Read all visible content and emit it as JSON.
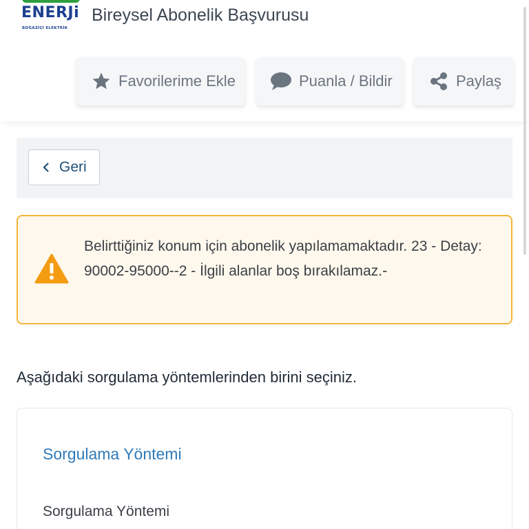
{
  "header": {
    "logo": {
      "word": "ENERJi",
      "sub": "BOĞAZİÇİ ELEKTRİK"
    },
    "title": "Bireysel Abonelik Başvurusu",
    "actions": {
      "favorite": "Favorilerime Ekle",
      "rate": "Puanla / Bildir",
      "share": "Paylaş"
    }
  },
  "back": {
    "label": "Geri"
  },
  "alert": {
    "message": "Belirttiğiniz konum için abonelik yapılamamaktadır. 23 - Detay: 90002-95000--2 - İlgili alanlar boş bırakılamaz.-"
  },
  "instruction": "Aşağıdaki sorgulama yöntemlerinden birini seçiniz.",
  "card": {
    "title": "Sorgulama Yöntemi",
    "field_label": "Sorgulama Yöntemi"
  },
  "colors": {
    "alert_border": "#f4b63a",
    "alert_icon": "#f39c12",
    "link_blue": "#2f7ab8",
    "brand_green": "#2e9e3e",
    "brand_navy": "#1d3f8f"
  }
}
